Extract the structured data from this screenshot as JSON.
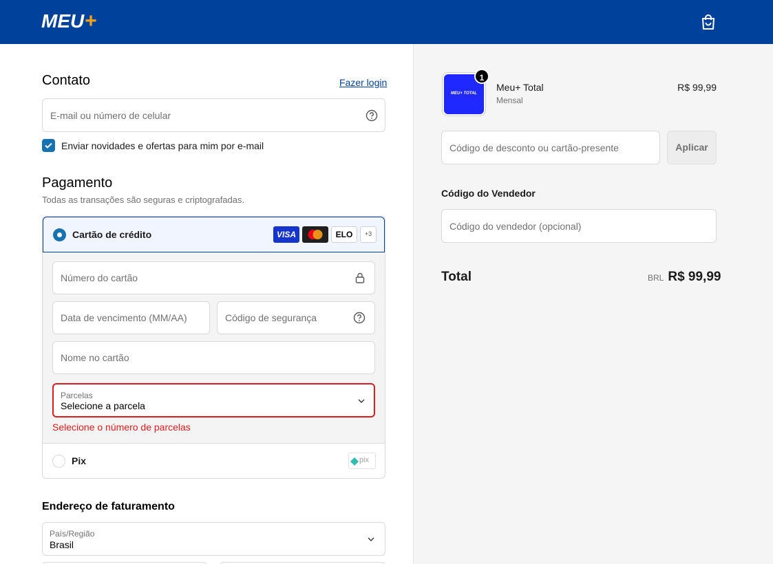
{
  "header": {
    "logo_text": "MEU",
    "logo_plus": "+",
    "cart_icon": "shopping-bag-icon",
    "background": "#00419b"
  },
  "contact": {
    "title": "Contato",
    "login_link": "Fazer login",
    "email_placeholder": "E-mail ou número de celular",
    "newsletter_label": "Enviar novidades e ofertas para mim por e-mail",
    "newsletter_checked": true
  },
  "payment": {
    "title": "Pagamento",
    "subtitle": "Todas as transações são seguras e criptografadas.",
    "credit_card": {
      "label": "Cartão de crédito",
      "selected": true,
      "brands": [
        "VISA",
        "mastercard",
        "ELO"
      ],
      "more_brands": "+3",
      "card_number_placeholder": "Número do cartão",
      "expiry_placeholder": "Data de vencimento (MM/AA)",
      "cvv_placeholder": "Código de segurança",
      "name_placeholder": "Nome no cartão",
      "installments_label": "Parcelas",
      "installments_value": "Selecione a parcela",
      "installments_error": "Selecione o número de parcelas"
    },
    "pix": {
      "label": "Pix",
      "selected": false,
      "logo_text": "pix"
    }
  },
  "billing": {
    "title": "Endereço de faturamento",
    "country_label": "País/Região",
    "country_value": "Brasil"
  },
  "summary": {
    "product_name": "Meu+ Total",
    "product_variant": "Mensal",
    "product_price": "R$ 99,99",
    "product_quantity": "1",
    "thumb_text": "MEU+ TOTAL",
    "discount_placeholder": "Código de desconto ou cartão-presente",
    "apply_button": "Aplicar",
    "seller_title": "Código do Vendedor",
    "seller_placeholder": "Código do vendedor (opcional)",
    "total_label": "Total",
    "total_currency": "BRL",
    "total_value": "R$ 99,99"
  },
  "colors": {
    "brand_blue": "#00419b",
    "accent_orange": "#f5a21b",
    "selected_blue": "#1773b0",
    "error_red": "#dd1d1d"
  }
}
